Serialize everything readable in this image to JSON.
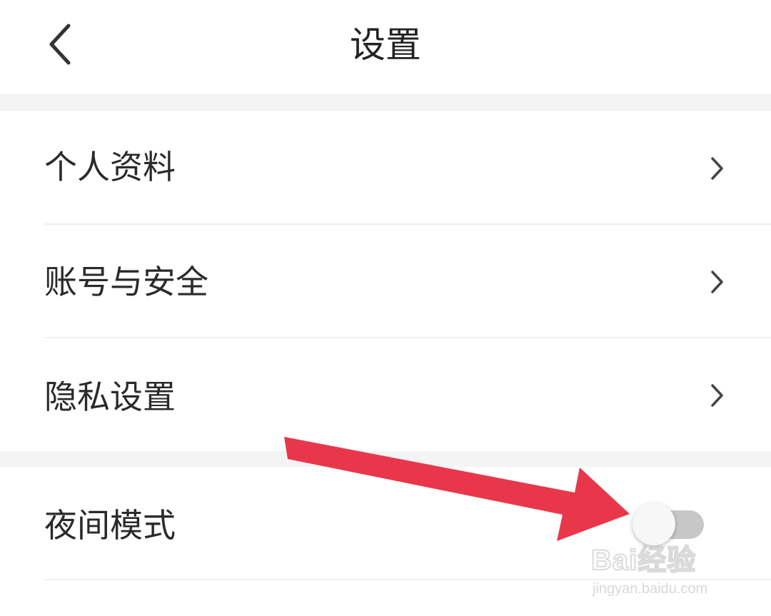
{
  "header": {
    "title": "设置",
    "back_icon": "chevron-left-icon"
  },
  "settings": {
    "items": [
      {
        "label": "个人资料",
        "icon": "chevron-right-icon"
      },
      {
        "label": "账号与安全",
        "icon": "chevron-right-icon"
      },
      {
        "label": "隐私设置",
        "icon": "chevron-right-icon"
      }
    ],
    "night_mode": {
      "label": "夜间模式",
      "enabled": false
    }
  },
  "annotation": {
    "arrow_color": "#e8374a",
    "arrow_target": "night-mode-toggle"
  },
  "watermark": {
    "brand": "Bai经验",
    "url": "jingyan.baidu.com"
  },
  "colors": {
    "background": "#ffffff",
    "section_gap": "#f4f4f4",
    "text": "#2a2a2a",
    "toggle_track_off": "#c7c7c7"
  }
}
